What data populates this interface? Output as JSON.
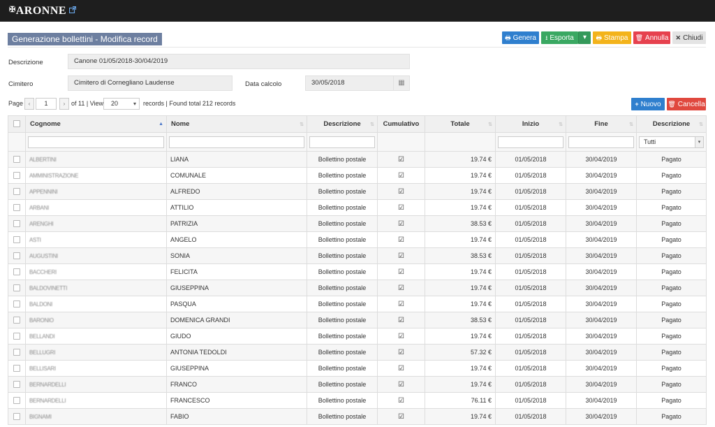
{
  "app": {
    "logo_text": "ARONNE",
    "logo_prefix": "A",
    "external_link_icon": "external-link-icon"
  },
  "page": {
    "title": "Generazione bollettini - Modifica record"
  },
  "toolbar": {
    "genera": "Genera",
    "esporta": "Esporta",
    "stampa": "Stampa",
    "annulla": "Annulla",
    "chiudi": "Chiudi",
    "nuovo": "Nuovo",
    "cancella": "Cancella"
  },
  "form": {
    "descrizione_label": "Descrizione",
    "descrizione_value": "Canone 01/05/2018-30/04/2019",
    "cimitero_label": "Cimitero",
    "cimitero_value": "Cimitero di Cornegliano Laudense",
    "data_calcolo_label": "Data calcolo",
    "data_calcolo_value": "30/05/2018"
  },
  "pager": {
    "page_label": "Page",
    "current_page": "1",
    "of_text": "of 11 | View",
    "page_size": "20",
    "summary": "records | Found total 212 records"
  },
  "table": {
    "columns": [
      "Cognome",
      "Nome",
      "Descrizione",
      "Cumulativo",
      "Totale",
      "Inizio",
      "Fine",
      "Descrizione"
    ],
    "filter_select_value": "Tutti",
    "rows": [
      {
        "cognome": "ALBERTINI",
        "nome": "LIANA",
        "descrizione": "Bollettino postale",
        "totale": "19.74 €",
        "inizio": "01/05/2018",
        "fine": "30/04/2019",
        "stato": "Pagato"
      },
      {
        "cognome": "AMMINISTRAZIONE",
        "nome": "COMUNALE",
        "descrizione": "Bollettino postale",
        "totale": "19.74 €",
        "inizio": "01/05/2018",
        "fine": "30/04/2019",
        "stato": "Pagato"
      },
      {
        "cognome": "APPENNINI",
        "nome": "ALFREDO",
        "descrizione": "Bollettino postale",
        "totale": "19.74 €",
        "inizio": "01/05/2018",
        "fine": "30/04/2019",
        "stato": "Pagato"
      },
      {
        "cognome": "ARBANI",
        "nome": "ATTILIO",
        "descrizione": "Bollettino postale",
        "totale": "19.74 €",
        "inizio": "01/05/2018",
        "fine": "30/04/2019",
        "stato": "Pagato"
      },
      {
        "cognome": "ARENGHI",
        "nome": "PATRIZIA",
        "descrizione": "Bollettino postale",
        "totale": "38.53 €",
        "inizio": "01/05/2018",
        "fine": "30/04/2019",
        "stato": "Pagato"
      },
      {
        "cognome": "ASTI",
        "nome": "ANGELO",
        "descrizione": "Bollettino postale",
        "totale": "19.74 €",
        "inizio": "01/05/2018",
        "fine": "30/04/2019",
        "stato": "Pagato"
      },
      {
        "cognome": "AUGUSTINI",
        "nome": "SONIA",
        "descrizione": "Bollettino postale",
        "totale": "38.53 €",
        "inizio": "01/05/2018",
        "fine": "30/04/2019",
        "stato": "Pagato"
      },
      {
        "cognome": "BACCHERI",
        "nome": "FELICITA",
        "descrizione": "Bollettino postale",
        "totale": "19.74 €",
        "inizio": "01/05/2018",
        "fine": "30/04/2019",
        "stato": "Pagato"
      },
      {
        "cognome": "BALDOVINETTI",
        "nome": "GIUSEPPINA",
        "descrizione": "Bollettino postale",
        "totale": "19.74 €",
        "inizio": "01/05/2018",
        "fine": "30/04/2019",
        "stato": "Pagato"
      },
      {
        "cognome": "BALDONI",
        "nome": "PASQUA",
        "descrizione": "Bollettino postale",
        "totale": "19.74 €",
        "inizio": "01/05/2018",
        "fine": "30/04/2019",
        "stato": "Pagato"
      },
      {
        "cognome": "BARONIO",
        "nome": "DOMENICA GRANDI",
        "descrizione": "Bollettino postale",
        "totale": "38.53 €",
        "inizio": "01/05/2018",
        "fine": "30/04/2019",
        "stato": "Pagato"
      },
      {
        "cognome": "BELLANDI",
        "nome": "GIUDO",
        "descrizione": "Bollettino postale",
        "totale": "19.74 €",
        "inizio": "01/05/2018",
        "fine": "30/04/2019",
        "stato": "Pagato"
      },
      {
        "cognome": "BELLUGRI",
        "nome": "ANTONIA TEDOLDI",
        "descrizione": "Bollettino postale",
        "totale": "57.32 €",
        "inizio": "01/05/2018",
        "fine": "30/04/2019",
        "stato": "Pagato"
      },
      {
        "cognome": "BELLISARI",
        "nome": "GIUSEPPINA",
        "descrizione": "Bollettino postale",
        "totale": "19.74 €",
        "inizio": "01/05/2018",
        "fine": "30/04/2019",
        "stato": "Pagato"
      },
      {
        "cognome": "BERNARDELLI",
        "nome": "FRANCO",
        "descrizione": "Bollettino postale",
        "totale": "19.74 €",
        "inizio": "01/05/2018",
        "fine": "30/04/2019",
        "stato": "Pagato"
      },
      {
        "cognome": "BERNARDELLI",
        "nome": "FRANCESCO",
        "descrizione": "Bollettino postale",
        "totale": "76.11 €",
        "inizio": "01/05/2018",
        "fine": "30/04/2019",
        "stato": "Pagato"
      },
      {
        "cognome": "BIGNAMI",
        "nome": "FABIO",
        "descrizione": "Bollettino postale",
        "totale": "19.74 €",
        "inizio": "01/05/2018",
        "fine": "30/04/2019",
        "stato": "Pagato"
      }
    ]
  }
}
